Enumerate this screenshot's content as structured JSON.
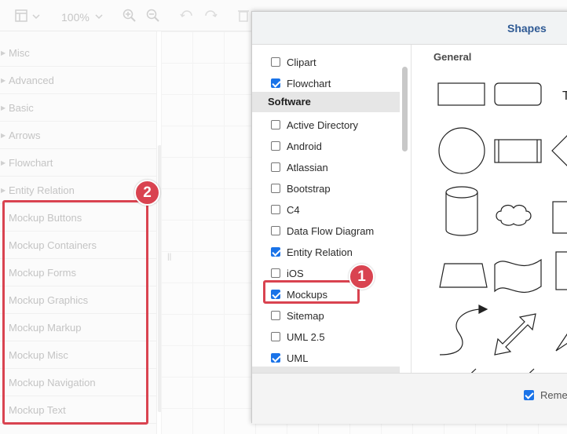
{
  "toolbar": {
    "zoom": "100%",
    "icons": [
      "panels-icon",
      "zoom-in-icon",
      "zoom-out-icon",
      "undo-icon",
      "redo-icon",
      "delete-icon"
    ]
  },
  "sidebar": {
    "items": [
      {
        "label": "Misc"
      },
      {
        "label": "Advanced"
      },
      {
        "label": "Basic"
      },
      {
        "label": "Arrows"
      },
      {
        "label": "Flowchart"
      },
      {
        "label": "Entity Relation"
      },
      {
        "label": "Mockup Buttons"
      },
      {
        "label": "Mockup Containers"
      },
      {
        "label": "Mockup Forms"
      },
      {
        "label": "Mockup Graphics"
      },
      {
        "label": "Mockup Markup"
      },
      {
        "label": "Mockup Misc"
      },
      {
        "label": "Mockup Navigation"
      },
      {
        "label": "Mockup Text"
      }
    ]
  },
  "dialog": {
    "title": "Shapes",
    "libraries": [
      {
        "label": "Clipart",
        "checked": false
      },
      {
        "label": "Flowchart",
        "checked": true
      },
      {
        "section": "Software"
      },
      {
        "label": "Active Directory",
        "checked": false
      },
      {
        "label": "Android",
        "checked": false
      },
      {
        "label": "Atlassian",
        "checked": false
      },
      {
        "label": "Bootstrap",
        "checked": false
      },
      {
        "label": "C4",
        "checked": false
      },
      {
        "label": "Data Flow Diagram",
        "checked": false
      },
      {
        "label": "Entity Relation",
        "checked": true
      },
      {
        "label": "iOS",
        "checked": false
      },
      {
        "label": "Mockups",
        "checked": true
      },
      {
        "label": "Sitemap",
        "checked": false
      },
      {
        "label": "UML 2.5",
        "checked": false
      },
      {
        "label": "UML",
        "checked": true
      }
    ],
    "preview_title": "General",
    "footer": {
      "remember_label": "Remer",
      "remember_checked": true
    }
  },
  "annotations": {
    "badge1": "1",
    "badge2": "2",
    "color": "#d94350"
  }
}
